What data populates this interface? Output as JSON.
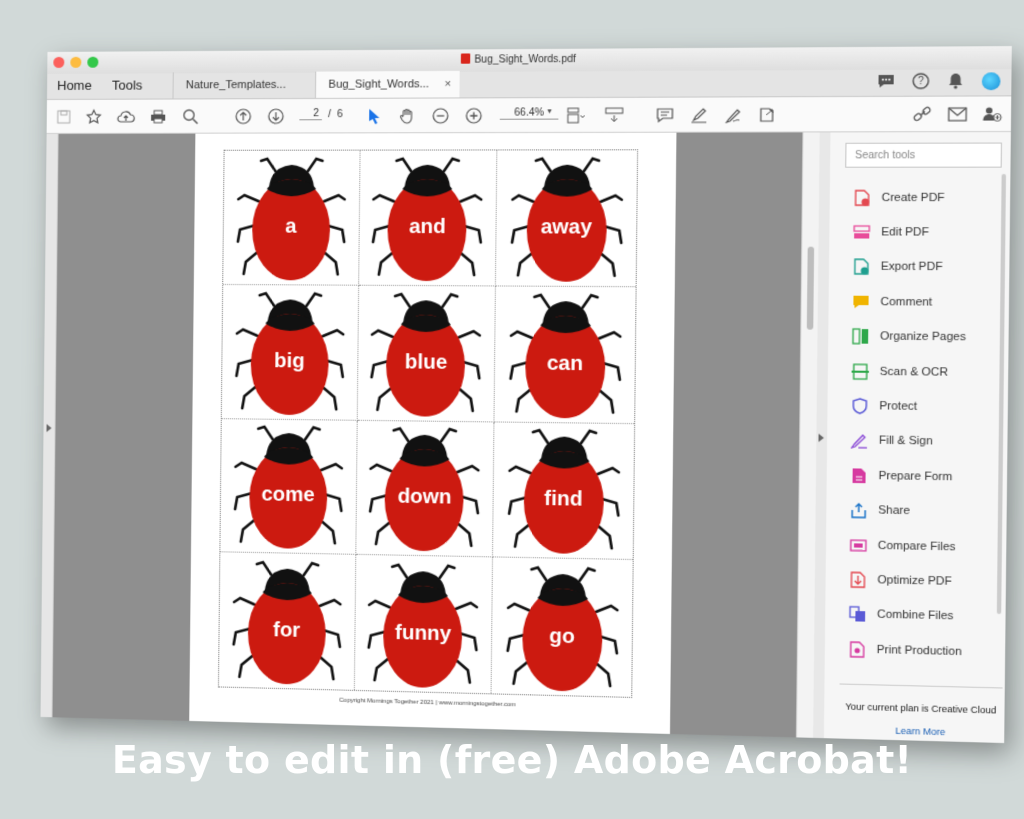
{
  "window": {
    "title": "Bug_Sight_Words.pdf"
  },
  "nav": {
    "home": "Home",
    "tools": "Tools"
  },
  "tabs": [
    {
      "label": "Nature_Templates..."
    },
    {
      "label": "Bug_Sight_Words...",
      "close": "×"
    }
  ],
  "toolbar": {
    "current_page": "2",
    "page_sep": "/",
    "total_pages": "6",
    "zoom": "66.4%"
  },
  "document": {
    "words": [
      "a",
      "and",
      "away",
      "big",
      "blue",
      "can",
      "come",
      "down",
      "find",
      "for",
      "funny",
      "go"
    ],
    "copyright": "Copyright Mornings Together 2021 | www.morningstogether.com",
    "bug_colors": {
      "shell": "#cc1a10",
      "head": "#111111"
    }
  },
  "tools_pane": {
    "search_placeholder": "Search tools",
    "items": [
      {
        "label": "Create PDF",
        "icon": "create-pdf-icon",
        "color": "#e34850"
      },
      {
        "label": "Edit PDF",
        "icon": "edit-pdf-icon",
        "color": "#e84b9a"
      },
      {
        "label": "Export PDF",
        "icon": "export-pdf-icon",
        "color": "#1f9f8f"
      },
      {
        "label": "Comment",
        "icon": "comment-icon",
        "color": "#f0b400"
      },
      {
        "label": "Organize Pages",
        "icon": "organize-pages-icon",
        "color": "#2ea84a"
      },
      {
        "label": "Scan & OCR",
        "icon": "scan-ocr-icon",
        "color": "#2ea84a"
      },
      {
        "label": "Protect",
        "icon": "protect-icon",
        "color": "#5a5ad6"
      },
      {
        "label": "Fill & Sign",
        "icon": "fill-sign-icon",
        "color": "#8a4ad6"
      },
      {
        "label": "Prepare Form",
        "icon": "prepare-form-icon",
        "color": "#d63aa0"
      },
      {
        "label": "Share",
        "icon": "share-icon",
        "color": "#1a73c8"
      },
      {
        "label": "Compare Files",
        "icon": "compare-files-icon",
        "color": "#d63aa0"
      },
      {
        "label": "Optimize PDF",
        "icon": "optimize-pdf-icon",
        "color": "#e34850"
      },
      {
        "label": "Combine Files",
        "icon": "combine-files-icon",
        "color": "#5a5ad6"
      },
      {
        "label": "Print Production",
        "icon": "print-production-icon",
        "color": "#d63aa0"
      }
    ],
    "plan_text": "Your current plan is Creative Cloud",
    "learn_more": "Learn More"
  },
  "caption": "Easy to edit in (free) Adobe Acrobat!"
}
